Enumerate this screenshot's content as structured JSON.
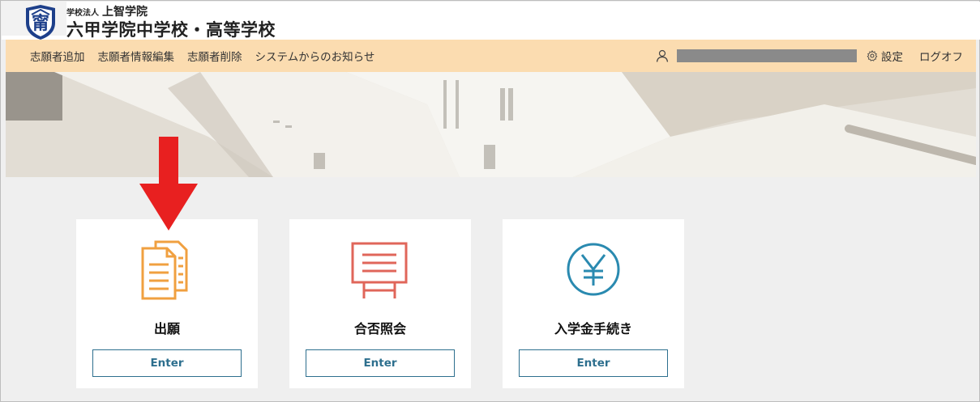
{
  "header": {
    "corp_prefix": "学校法人",
    "corp_name": "上智学院",
    "school_name": "六甲学院中学校・高等学校",
    "logo_icon": "school-emblem-icon"
  },
  "nav": {
    "items": [
      {
        "label": "志願者追加"
      },
      {
        "label": "志願者情報編集"
      },
      {
        "label": "志願者削除"
      },
      {
        "label": "システムからのお知らせ"
      }
    ],
    "user_icon": "user-icon",
    "settings_icon": "gear-icon",
    "settings_label": "設定",
    "logoff_label": "ログオフ"
  },
  "cards": [
    {
      "title": "出願",
      "button_label": "Enter",
      "icon": "documents-icon",
      "icon_color": "#f0a040"
    },
    {
      "title": "合否照会",
      "button_label": "Enter",
      "icon": "notice-board-icon",
      "icon_color": "#e0665a"
    },
    {
      "title": "入学金手続き",
      "button_label": "Enter",
      "icon": "yen-icon",
      "icon_color": "#2a8ab0"
    }
  ],
  "colors": {
    "nav_bg": "#fbdcb0",
    "page_bg": "#efefef",
    "button_accent": "#2d6f8e",
    "arrow": "#e02020"
  }
}
